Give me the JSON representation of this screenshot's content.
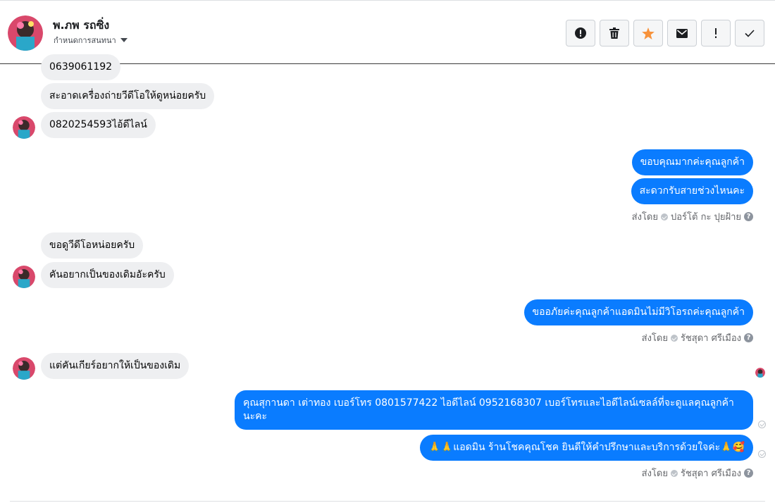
{
  "header": {
    "name": "พ.ภพ รถซิ่ง",
    "subtitle": "กำหนดการสนทนา",
    "toolbar_icons": [
      "alert-circle-icon",
      "trash-icon",
      "star-icon",
      "envelope-icon",
      "exclamation-icon",
      "check-icon"
    ],
    "star_color": "#f7923b"
  },
  "messages": {
    "in1": "0639061192",
    "in2": "สะอาดเครื่องถ่ายวีดีโอให้ดูหน่อยครับ",
    "in3": "0820254593ไอ้ดีไลน์",
    "out1": "ขอบคุณมากค่ะคุณลูกค้า",
    "out2": "สะดวกรับสายช่วงไหนคะ",
    "in4": "ขอดูวีดีโอหน่อยครับ",
    "in5": "คันอยากเป็นของเดิมอัะครับ",
    "out3": "ขออภัยค่ะคุณลูกค้าแอดมินไม่มีวิโอรถค่ะคุณลูกค้า",
    "in6": "แต่คันเกียร์อยากให้เป็นของเดิม",
    "out4": "คุณสุกานดา เต่าทอง      เบอร์โทร 0801577422  ไอดีไลน์ 0952168307   เบอร์โทรและไอดีไลน์เซลล์ที่จะดูแลคุณลูกค้านะคะ",
    "out5": "🙏🙏แอดมิน ร้านโชคคุณโชค ยินดีให้คำปรึกษาและบริการด้วยใจค่ะ🙏🥰"
  },
  "sent_by": {
    "label1": "ส่งโดย",
    "name1": "ปอร์โต้ กะ ปุยฝ้าย",
    "label2": "ส่งโดย",
    "name2": "รัชสุดา ศรีเมือง",
    "label3": "ส่งโดย",
    "name3": "รัชสุดา ศรีเมือง"
  },
  "colors": {
    "outgoing_bubble": "#0a7cff",
    "incoming_bubble": "#eeeff1"
  }
}
